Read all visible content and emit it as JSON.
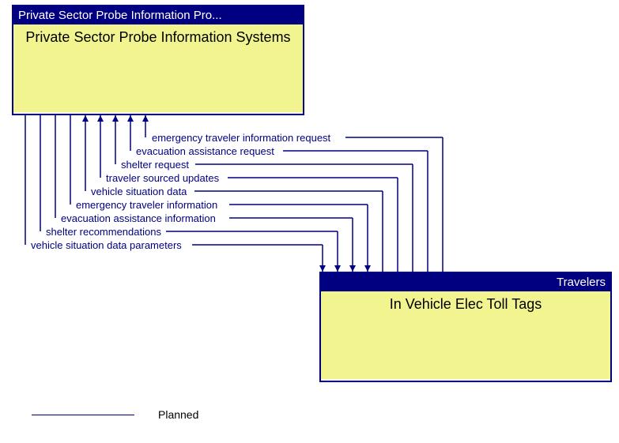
{
  "nodes": {
    "source": {
      "header": "Private Sector Probe Information Pro...",
      "title": "Private Sector Probe Information Systems"
    },
    "target": {
      "header": "Travelers",
      "title": "In Vehicle Elec Toll Tags"
    }
  },
  "flows": [
    {
      "label": "emergency traveler information request",
      "direction": "to_source"
    },
    {
      "label": "evacuation assistance request",
      "direction": "to_source"
    },
    {
      "label": "shelter request",
      "direction": "to_source"
    },
    {
      "label": "traveler sourced updates",
      "direction": "to_source"
    },
    {
      "label": "vehicle situation data",
      "direction": "to_source"
    },
    {
      "label": "emergency traveler information",
      "direction": "to_target"
    },
    {
      "label": "evacuation assistance information",
      "direction": "to_target"
    },
    {
      "label": "shelter recommendations",
      "direction": "to_target"
    },
    {
      "label": "vehicle situation data parameters",
      "direction": "to_target"
    }
  ],
  "legend": {
    "planned": "Planned"
  }
}
